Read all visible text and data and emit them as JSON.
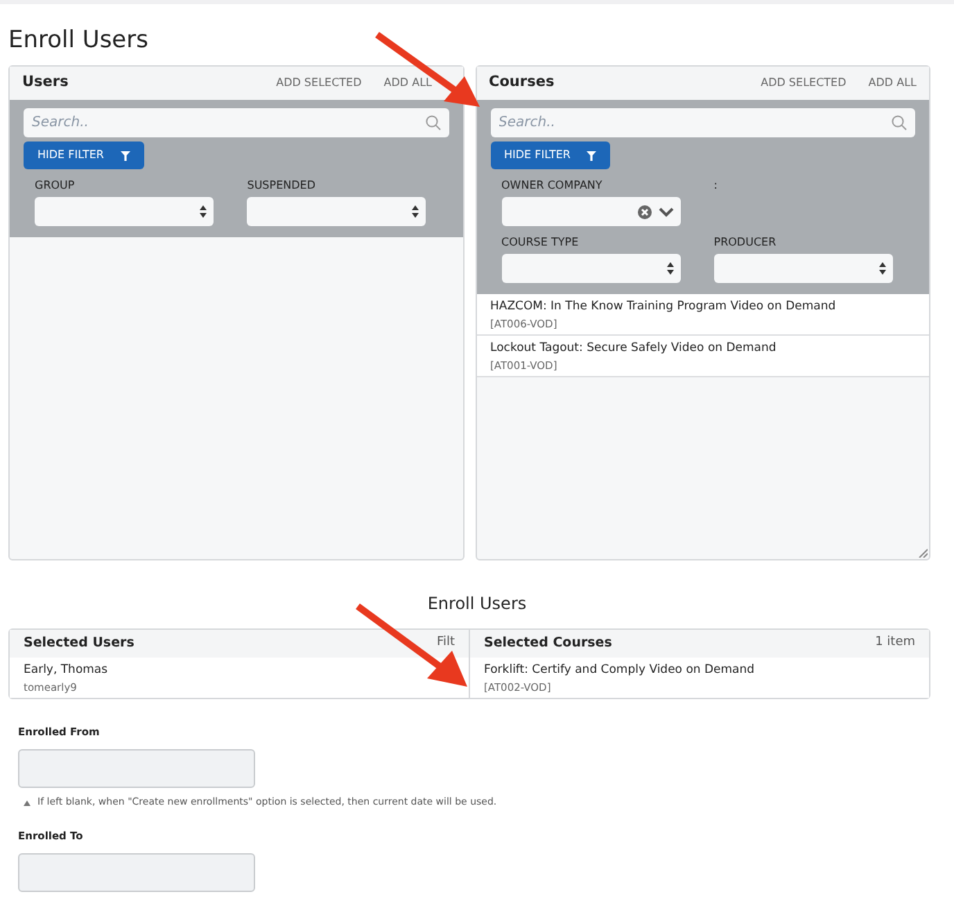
{
  "page_title": "Enroll Users",
  "panels": [
    {
      "title": "Users",
      "actions": [
        "ADD SELECTED",
        "ADD ALL"
      ],
      "search": {
        "placeholder": "Search.."
      },
      "filter_button": "HIDE FILTER",
      "filters": [
        [
          {
            "label": "GROUP",
            "kind": "select"
          },
          {
            "label": "SUSPENDED",
            "kind": "select"
          }
        ]
      ],
      "resizable": false
    },
    {
      "title": "Courses",
      "actions": [
        "ADD SELECTED",
        "ADD ALL"
      ],
      "search": {
        "placeholder": "Search.."
      },
      "filter_button": "HIDE FILTER",
      "filters": [
        [
          {
            "label": "OWNER COMPANY",
            "kind": "combo"
          },
          {
            "label": ":",
            "kind": "label"
          }
        ],
        [
          {
            "label": "COURSE TYPE",
            "kind": "select"
          },
          {
            "label": "PRODUCER",
            "kind": "select"
          }
        ]
      ],
      "items": [
        {
          "name": "HAZCOM: In The Know Training Program Video on Demand",
          "code": "[AT006-VOD]"
        },
        {
          "name": "Lockout Tagout: Secure Safely Video on Demand",
          "code": "[AT001-VOD]"
        }
      ],
      "resizable": true
    }
  ],
  "section_title": "Enroll Users",
  "selected": [
    {
      "title": "Selected Users",
      "aside": "Filt",
      "items": [
        {
          "name": "Early, Thomas",
          "code": "tomearly9"
        }
      ]
    },
    {
      "title": "Selected Courses",
      "aside": "1 item",
      "items": [
        {
          "name": "Forklift: Certify and Comply Video on Demand",
          "code": "[AT002-VOD]"
        }
      ]
    }
  ],
  "fields": [
    {
      "label": "Enrolled From",
      "hint": "If left blank, when \"Create new enrollments\" option is selected, then current date will be used."
    },
    {
      "label": "Enrolled To"
    }
  ]
}
